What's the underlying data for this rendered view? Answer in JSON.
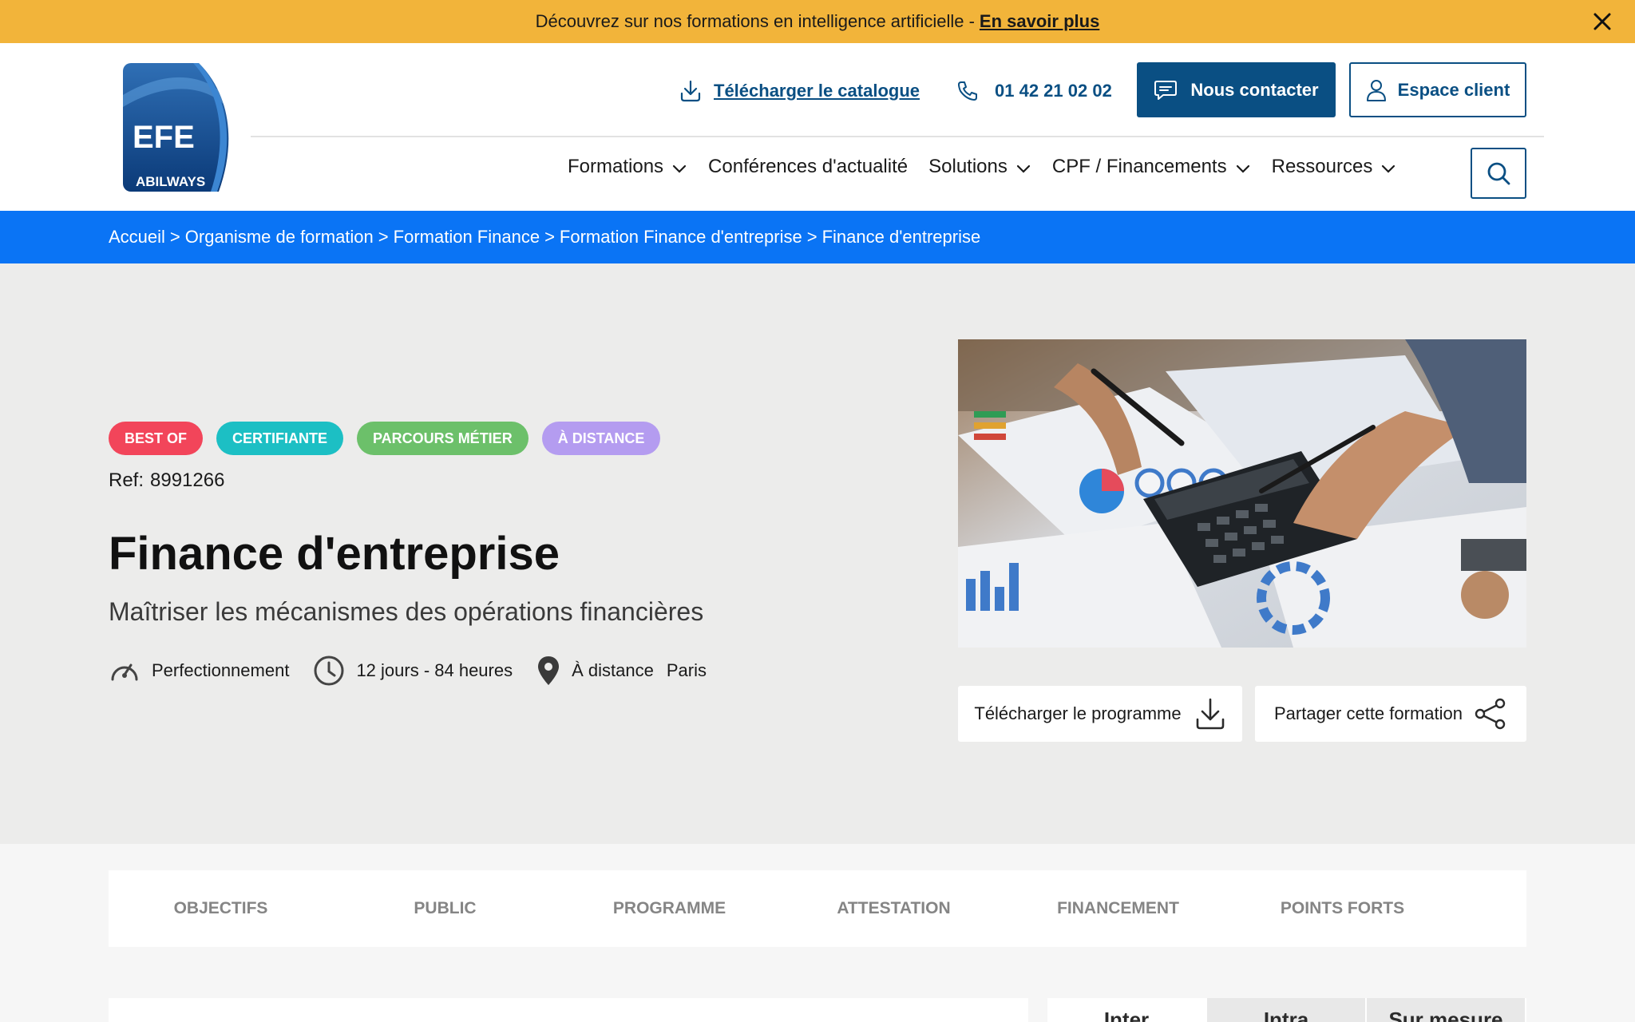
{
  "banner": {
    "text": "Découvrez sur nos formations en intelligence artificielle -",
    "link": "En savoir plus"
  },
  "logo": {
    "main": "EFE",
    "sub": "ABILWAYS"
  },
  "header": {
    "catalogue": "Télécharger le catalogue",
    "phone": "01 42 21 02 02",
    "contact": "Nous contacter",
    "client": "Espace client"
  },
  "nav": [
    {
      "label": "Formations",
      "dropdown": true
    },
    {
      "label": "Conférences d'actualité",
      "dropdown": false
    },
    {
      "label": "Solutions",
      "dropdown": true
    },
    {
      "label": "CPF / Financements",
      "dropdown": true
    },
    {
      "label": "Ressources",
      "dropdown": true
    }
  ],
  "breadcrumb": [
    "Accueil",
    "Organisme de formation",
    "Formation Finance",
    "Formation Finance d'entreprise",
    "Finance d'entreprise"
  ],
  "breadcrumb_sep": ">",
  "tags": [
    {
      "label": "BEST OF",
      "color": "#f2455a"
    },
    {
      "label": "CERTIFIANTE",
      "color": "#1cbfc4"
    },
    {
      "label": "PARCOURS MÉTIER",
      "color": "#6cc06a"
    },
    {
      "label": "À DISTANCE",
      "color": "#b49cf0"
    }
  ],
  "ref": {
    "label": "Ref:",
    "value": "8991266"
  },
  "title": "Finance d'entreprise",
  "subtitle": "Maîtriser les mécanismes des opérations financières",
  "meta": {
    "level": "Perfectionnement",
    "duration": "12 jours - 84 heures",
    "mode": "À distance",
    "city": "Paris"
  },
  "actions": {
    "program": "Télécharger le programme",
    "share": "Partager cette formation"
  },
  "tabs": [
    "OBJECTIFS",
    "PUBLIC",
    "PROGRAMME",
    "ATTESTATION",
    "FINANCEMENT",
    "POINTS FORTS"
  ],
  "offer_tabs": [
    "Inter",
    "Intra",
    "Sur mesure"
  ],
  "colors": {
    "banner": "#f2b43a",
    "brand": "#0a4f83",
    "breadcrumb": "#0a74f5"
  },
  "icons": {
    "download": "download-icon",
    "phone": "phone-icon",
    "chat": "chat-icon",
    "user": "user-icon",
    "search": "search-icon",
    "close": "close-icon"
  }
}
